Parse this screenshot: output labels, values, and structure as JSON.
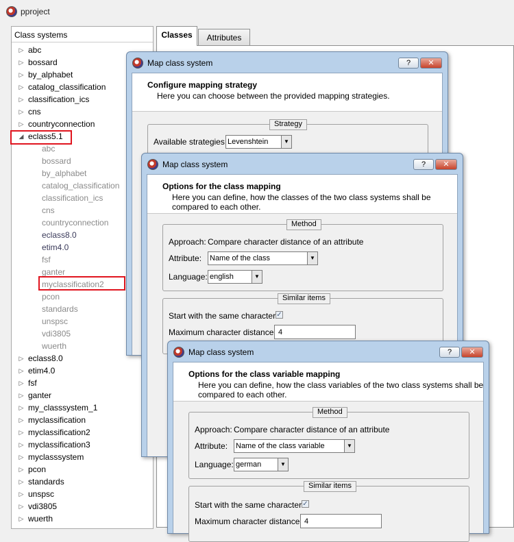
{
  "app": {
    "title": "pproject"
  },
  "tree": {
    "header": "Class systems",
    "items": [
      {
        "label": "abc",
        "arrow": "▷"
      },
      {
        "label": "bossard",
        "arrow": "▷"
      },
      {
        "label": "by_alphabet",
        "arrow": "▷"
      },
      {
        "label": "catalog_classification",
        "arrow": "▷"
      },
      {
        "label": "classification_ics",
        "arrow": "▷"
      },
      {
        "label": "cns",
        "arrow": "▷"
      },
      {
        "label": "countryconnection",
        "arrow": "▷"
      },
      {
        "label": "eclass5.1",
        "arrow": "◢"
      },
      {
        "label": "abc",
        "arrow": ""
      },
      {
        "label": "bossard",
        "arrow": ""
      },
      {
        "label": "by_alphabet",
        "arrow": ""
      },
      {
        "label": "catalog_classification",
        "arrow": ""
      },
      {
        "label": "classification_ics",
        "arrow": ""
      },
      {
        "label": "cns",
        "arrow": ""
      },
      {
        "label": "countryconnection",
        "arrow": ""
      },
      {
        "label": "eclass8.0",
        "arrow": ""
      },
      {
        "label": "etim4.0",
        "arrow": ""
      },
      {
        "label": "fsf",
        "arrow": ""
      },
      {
        "label": "ganter",
        "arrow": ""
      },
      {
        "label": "myclassification2",
        "arrow": ""
      },
      {
        "label": "pcon",
        "arrow": ""
      },
      {
        "label": "standards",
        "arrow": ""
      },
      {
        "label": "unspsc",
        "arrow": ""
      },
      {
        "label": "vdi3805",
        "arrow": ""
      },
      {
        "label": "wuerth",
        "arrow": ""
      },
      {
        "label": "eclass8.0",
        "arrow": "▷"
      },
      {
        "label": "etim4.0",
        "arrow": "▷"
      },
      {
        "label": "fsf",
        "arrow": "▷"
      },
      {
        "label": "ganter",
        "arrow": "▷"
      },
      {
        "label": "my_classsystem_1",
        "arrow": "▷"
      },
      {
        "label": "myclassification",
        "arrow": "▷"
      },
      {
        "label": "myclassification2",
        "arrow": "▷"
      },
      {
        "label": "myclassification3",
        "arrow": "▷"
      },
      {
        "label": "myclasssystem",
        "arrow": "▷"
      },
      {
        "label": "pcon",
        "arrow": "▷"
      },
      {
        "label": "standards",
        "arrow": "▷"
      },
      {
        "label": "unspsc",
        "arrow": "▷"
      },
      {
        "label": "vdi3805",
        "arrow": "▷"
      },
      {
        "label": "wuerth",
        "arrow": "▷"
      }
    ]
  },
  "tabs": {
    "classes": "Classes",
    "attributes": "Attributes"
  },
  "dialog1": {
    "title": "Map class system",
    "help": "?",
    "close": "✕",
    "header_title": "Configure mapping strategy",
    "header_desc": "Here you can choose between the provided mapping strategies.",
    "group_label": "Strategy",
    "strategies_label": "Available strategies:",
    "strategy_value": "Levenshtein"
  },
  "dialog2": {
    "title": "Map class system",
    "help": "?",
    "close": "✕",
    "header_title": "Options for the class mapping",
    "header_desc": "Here you can define, how the classes of the two class systems shall be compared to each other.",
    "method_label": "Method",
    "approach_label": "Approach:",
    "approach_value": "Compare character distance of an attribute",
    "attribute_label": "Attribute:",
    "attribute_value": "Name of the class",
    "language_label": "Language:",
    "language_value": "english",
    "similar_label": "Similar items",
    "start_same_label": "Start with the same character:",
    "start_same_checked": true,
    "max_distance_label": "Maximum character distance:",
    "max_distance_value": "4"
  },
  "dialog3": {
    "title": "Map class system",
    "help": "?",
    "close": "✕",
    "header_title": "Options for the class variable mapping",
    "header_desc": "Here you can define, how the class variables of the two class systems shall be compared to each other.",
    "method_label": "Method",
    "approach_label": "Approach:",
    "approach_value": "Compare character distance of an attribute",
    "attribute_label": "Attribute:",
    "attribute_value": "Name of the class variable",
    "language_label": "Language:",
    "language_value": "german",
    "similar_label": "Similar items",
    "start_same_label": "Start with the same character:",
    "start_same_checked": true,
    "max_distance_label": "Maximum character distance:",
    "max_distance_value": "4"
  },
  "colors": {
    "highlight": "#e0141e",
    "dialog_frame": "#b9d1ea"
  }
}
